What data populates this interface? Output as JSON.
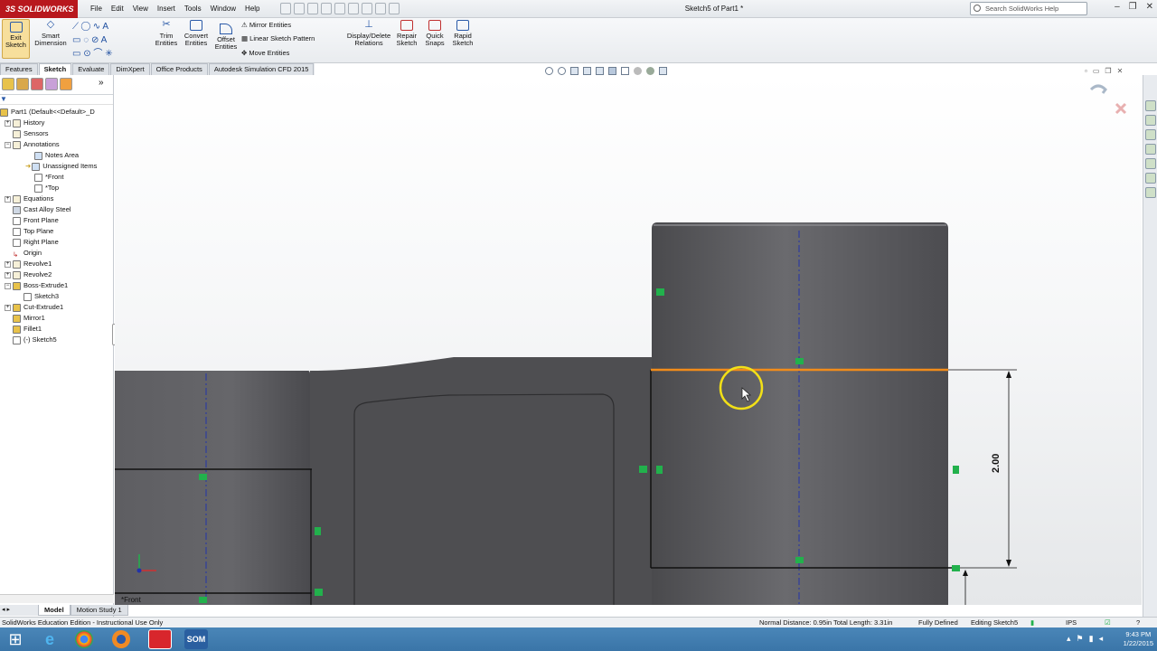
{
  "app": {
    "logo": "3S SOLIDWORKS",
    "window_title": "Sketch5 of Part1 *"
  },
  "menu": [
    "File",
    "Edit",
    "View",
    "Insert",
    "Tools",
    "Window",
    "Help"
  ],
  "search": {
    "placeholder": "Search SolidWorks Help"
  },
  "ribbon": {
    "exit_sketch": "Exit Sketch",
    "smart_dimension": "Smart Dimension",
    "trim_entities": "Trim Entities",
    "convert_entities": "Convert Entities",
    "offset_entities": "Offset Entities",
    "mirror_entities": "Mirror Entities",
    "linear_sketch_pattern": "Linear Sketch Pattern",
    "move_entities": "Move Entities",
    "display_delete_relations": "Display/Delete Relations",
    "repair_sketch": "Repair Sketch",
    "quick_snaps": "Quick Snaps",
    "rapid_sketch": "Rapid Sketch"
  },
  "tabs": [
    "Features",
    "Sketch",
    "Evaluate",
    "DimXpert",
    "Office Products",
    "Autodesk Simulation CFD 2015"
  ],
  "active_tab": "Sketch",
  "tree": {
    "root": "Part1  (Default<<Default>_D",
    "items": [
      "History",
      "Sensors",
      "Annotations",
      "Notes Area",
      "Unassigned Items",
      "*Front",
      "*Top",
      "Equations",
      "Cast Alloy Steel",
      "Front Plane",
      "Top Plane",
      "Right Plane",
      "Origin",
      "Revolve1",
      "Revolve2",
      "Boss-Extrude1",
      "Sketch3",
      "Cut-Extrude1",
      "Mirror1",
      "Fillet1",
      "(-) Sketch5"
    ]
  },
  "bottom_tabs": [
    "Model",
    "Motion Study 1"
  ],
  "viewport": {
    "view_label": "*Front",
    "dimension": "2.00",
    "accent_orange": "#f28c1a",
    "relation_green": "#22b14c"
  },
  "status": {
    "edition": "SolidWorks Education Edition - Instructional Use Only",
    "measure": "Normal Distance: 0.95in Total Length: 3.31in",
    "state": "Fully Defined",
    "editing": "Editing Sketch5",
    "units": "IPS"
  },
  "taskbar": {
    "time": "9:43 PM",
    "date": "1/22/2015"
  }
}
